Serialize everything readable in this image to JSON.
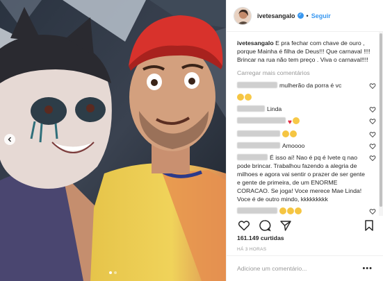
{
  "post": {
    "username": "ivetesangalo",
    "verified": true,
    "follow_label": "Seguir",
    "separator": "•",
    "caption_user": "ivetesangalo",
    "caption_text": "E pra fechar com chave de ouro , porque Mainha é filha de Deus!!! Que carnaval !!!! Brincar na rua não tem preço . Viva o carnaval!!!!",
    "load_more": "Carregar mais comentários",
    "likes": "161.149 curtidas",
    "time": "HÁ 3 HORAS",
    "add_comment_placeholder": "Adicione um comentário...",
    "more_options": "•••"
  },
  "comments": [
    {
      "text": "mulherão da porra é vc",
      "emojis": []
    },
    {
      "text": "",
      "emojis": [
        "clap",
        "laugh"
      ]
    },
    {
      "text": "Linda",
      "emojis": []
    },
    {
      "text": "",
      "emojis": [
        "heart",
        "laugh"
      ]
    },
    {
      "text": "",
      "emojis": [
        "clap",
        "clap"
      ]
    },
    {
      "text": "Amoooo",
      "emojis": []
    },
    {
      "text": "É isso aí! Nao é pq é Ivete q nao pode brincar. Trabalhou fazendo a alegria de milhoes e agora vai sentir o prazer de ser gente e gente de primeira, de um ENORME CORACAO. Se joga! Voce merece Mae Linda! Voce é de outro mindo, kkkkkkkkk",
      "emojis": []
    },
    {
      "text": "",
      "emojis": [
        "clap",
        "clap",
        "clap"
      ]
    }
  ],
  "icons": {
    "like": "heart-outline-icon",
    "comment": "speech-bubble-icon",
    "share": "paper-plane-icon",
    "save": "bookmark-icon",
    "carousel_prev": "chevron-left-icon",
    "comment_like": "small-heart-icon"
  },
  "colors": {
    "accent": "#3897f0",
    "muted": "#999999",
    "text": "#262626",
    "border": "#efefef"
  }
}
